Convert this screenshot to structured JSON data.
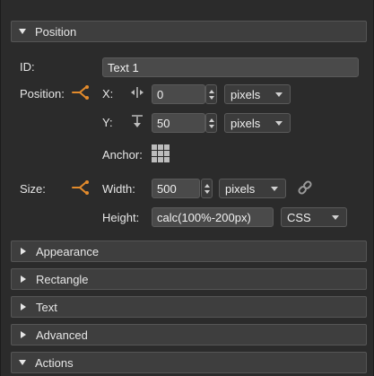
{
  "sections": {
    "position": {
      "label": "Position",
      "expanded": true
    },
    "appearance": {
      "label": "Appearance"
    },
    "rectangle": {
      "label": "Rectangle"
    },
    "text": {
      "label": "Text"
    },
    "advanced": {
      "label": "Advanced"
    },
    "actions": {
      "label": "Actions"
    }
  },
  "id_row": {
    "label": "ID:",
    "value": "Text 1"
  },
  "position_row": {
    "label": "Position:",
    "x_label": "X:",
    "x_value": "0",
    "x_unit": "pixels",
    "y_label": "Y:",
    "y_value": "50",
    "y_unit": "pixels",
    "anchor_label": "Anchor:"
  },
  "size_row": {
    "label": "Size:",
    "width_label": "Width:",
    "width_value": "500",
    "width_unit": "pixels",
    "height_label": "Height:",
    "height_value": "calc(100%-200px)",
    "height_unit": "CSS"
  },
  "icons": {
    "link_icon": "chain-link-icon",
    "anchor_icon": "position-link-icon",
    "x_icon": "horizontal-resize-icon",
    "y_icon": "vertical-align-icon",
    "anchor_grid": "anchor-grid-icon"
  },
  "colors": {
    "accent_orange": "#e38b2c",
    "panel_bg": "#2b2b2b",
    "header_bg": "#3e3e3e"
  }
}
